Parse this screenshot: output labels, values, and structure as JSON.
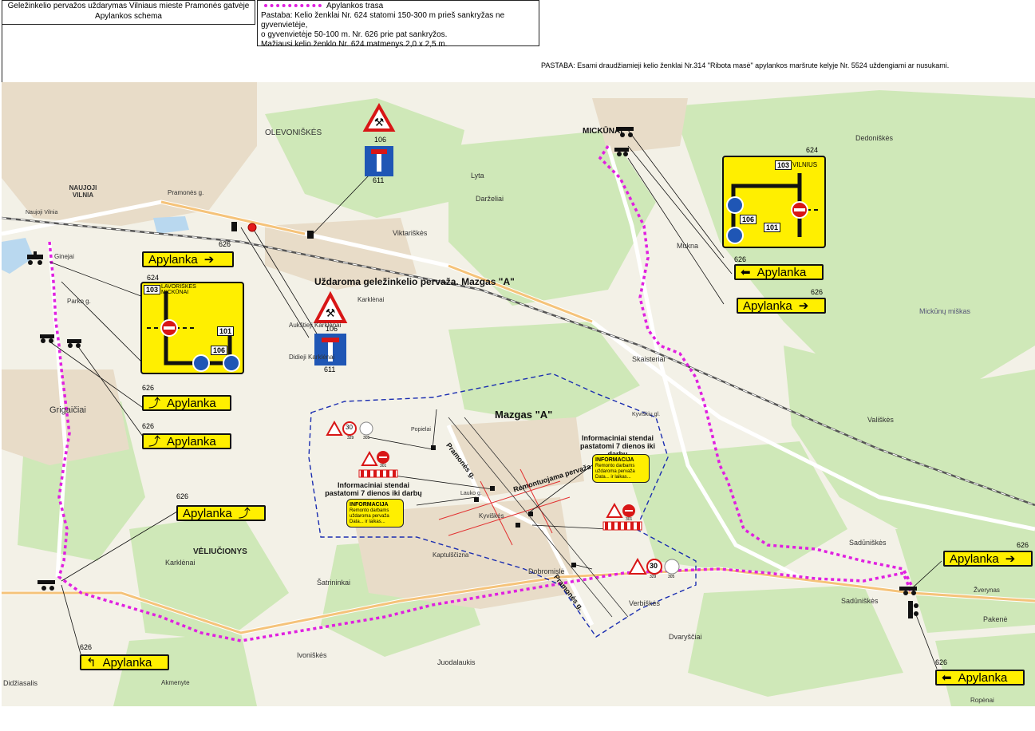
{
  "header": {
    "title_line1": "Geležinkelio pervažos uždarymas Vilniaus mieste Pramonės gatvėje",
    "title_line2": "Apylankos schema",
    "legend_label": "Apylankos trasa",
    "note_line1": "Pastaba: Kelio ženklai Nr. 624 statomi 150-300 m prieš sankryžas ne gyvenvietėje,",
    "note_line2": "o gyvenvietėje 50-100 m. Nr. 626 prie pat sankryžos.",
    "note_line3": "Mažiausi kelio ženklo Nr. 624 matmenys 2,0 x 2,5 m.",
    "top_note": "PASTABA: Esami draudžiamieji kelio ženklai Nr.314 \"Ribota masė\"  apylankos maršrute kelyje Nr. 5524 uždengiami ar nusukami."
  },
  "colors": {
    "detour_route": "#e020e0",
    "sign_yellow": "#ffef00",
    "zone_outline": "#1a2db0",
    "map_forest": "#cfe8b8",
    "map_field": "#f2f0e6"
  },
  "map": {
    "place_labels": [
      "OLEVONIŠKĖS",
      "NAUJOJI VILNIA",
      "MICKŪNAI",
      "Dedoniškės",
      "Lyta",
      "Darželiai",
      "Viktariškės",
      "Mukna",
      "Pramonės g.",
      "Ginejai",
      "Parko g.",
      "Karklėnai",
      "Aukštieji Karklėnai",
      "Didieji Karklėnai",
      "Skaisteriai",
      "Kyviškių gl.",
      "Vališkės",
      "Grigaičiai",
      "VĖLIUČIONYS",
      "Karklėnai",
      "Šatrininkai",
      "Dobromislė",
      "Verbiškės",
      "Sadūniškės",
      "Sadūniškės",
      "Pakenė",
      "Dvaryščiai",
      "Ivoniškės",
      "Juodalaukis",
      "Didžiasalis",
      "Akmenyte",
      "Ropėnai",
      "Popielai",
      "Lauko g.",
      "Kyviškės",
      "Kaptulščizna",
      "Žverynas",
      "Mickūnų miškas",
      "Naujoji Vilnia"
    ],
    "crossing_title": "Uždaroma geležinkelio pervaža. Mazgas \"A\"",
    "node_title": "Mazgas \"A\"",
    "info_stand_1": "Informaciniai stendai pastatomi 7 dienos iki darbų",
    "info_stand_2": "Informaciniai stendai pastatomi 7 dienos iki darbų",
    "info_box_title": "INFORMACIJA",
    "info_box_text": "Remonto darbams uždaroma pervaža Data... ir laikas...",
    "repair_label": "Remontuojama pervaža",
    "street_pramones": "Pramonės g.",
    "street_pramones_2": "Pramonės g."
  },
  "detour_signs": [
    {
      "id": "s1",
      "label": "Apylanka",
      "code": "626",
      "arrow": "right"
    },
    {
      "id": "s2",
      "label": "Apylanka",
      "code": "626",
      "arrow": "left"
    },
    {
      "id": "s3",
      "label": "Apylanka",
      "code": "626",
      "arrow": "right"
    },
    {
      "id": "s4",
      "label": "Apylanka",
      "code": "626",
      "arrow": "squiggle"
    },
    {
      "id": "s5",
      "label": "Apylanka",
      "code": "626",
      "arrow": "squiggle"
    },
    {
      "id": "s6",
      "label": "Apylanka",
      "code": "626",
      "arrow": "squiggle"
    },
    {
      "id": "s7",
      "label": "Apylanka",
      "code": "626",
      "arrow": "right"
    },
    {
      "id": "s8",
      "label": "Apylanka",
      "code": "626",
      "arrow": "turn-left"
    },
    {
      "id": "s9",
      "label": "Apylanka",
      "code": "626",
      "arrow": "left"
    }
  ],
  "big_signs": {
    "left": {
      "code": "624",
      "route": "103",
      "dest1": "LAVORIŠKĖS",
      "dest2": "MICKŪNAI",
      "r101": "101",
      "r106": "106"
    },
    "right": {
      "code": "624",
      "route": "103",
      "dest1": "VILNIUS",
      "r101": "101",
      "r106": "106"
    }
  },
  "road_signs": {
    "work": "106",
    "dead_end": "611",
    "speed": "30",
    "sign_329": "329",
    "sign_305": "305",
    "sign_301": "301"
  }
}
